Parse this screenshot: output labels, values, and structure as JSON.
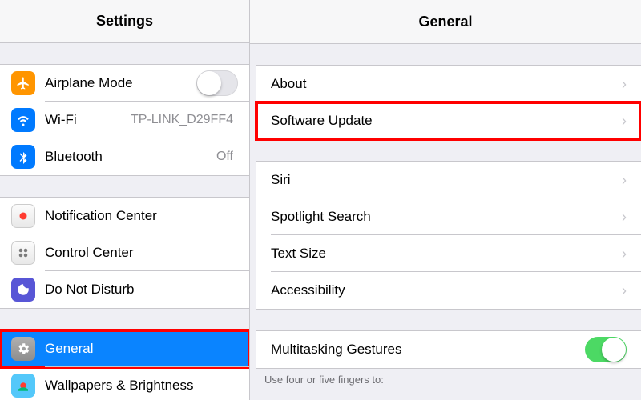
{
  "sidebar": {
    "title": "Settings",
    "groups": [
      {
        "items": [
          {
            "id": "airplane",
            "label": "Airplane Mode",
            "control": "toggle",
            "toggle_on": false
          },
          {
            "id": "wifi",
            "label": "Wi-Fi",
            "value": "TP-LINK_D29FF4"
          },
          {
            "id": "bluetooth",
            "label": "Bluetooth",
            "value": "Off"
          }
        ]
      },
      {
        "items": [
          {
            "id": "notif",
            "label": "Notification Center"
          },
          {
            "id": "control",
            "label": "Control Center"
          },
          {
            "id": "dnd",
            "label": "Do Not Disturb"
          }
        ]
      },
      {
        "items": [
          {
            "id": "general",
            "label": "General",
            "selected": true,
            "highlighted": true
          },
          {
            "id": "wallpaper",
            "label": "Wallpapers & Brightness"
          }
        ]
      }
    ]
  },
  "detail": {
    "title": "General",
    "groups": [
      {
        "items": [
          {
            "id": "about",
            "label": "About"
          },
          {
            "id": "software-update",
            "label": "Software Update",
            "highlighted": true
          }
        ]
      },
      {
        "items": [
          {
            "id": "siri",
            "label": "Siri"
          },
          {
            "id": "spotlight",
            "label": "Spotlight Search"
          },
          {
            "id": "textsize",
            "label": "Text Size"
          },
          {
            "id": "accessibility",
            "label": "Accessibility"
          }
        ]
      },
      {
        "items": [
          {
            "id": "multitasking",
            "label": "Multitasking Gestures",
            "control": "toggle",
            "toggle_on": true
          }
        ],
        "footer": "Use four or five fingers to:"
      }
    ]
  },
  "colors": {
    "highlight": "#ff0000",
    "selection": "#0a84ff",
    "toggle_on": "#4cd964",
    "airplane_icon": "#ff9500",
    "wifi_icon": "#007aff"
  }
}
